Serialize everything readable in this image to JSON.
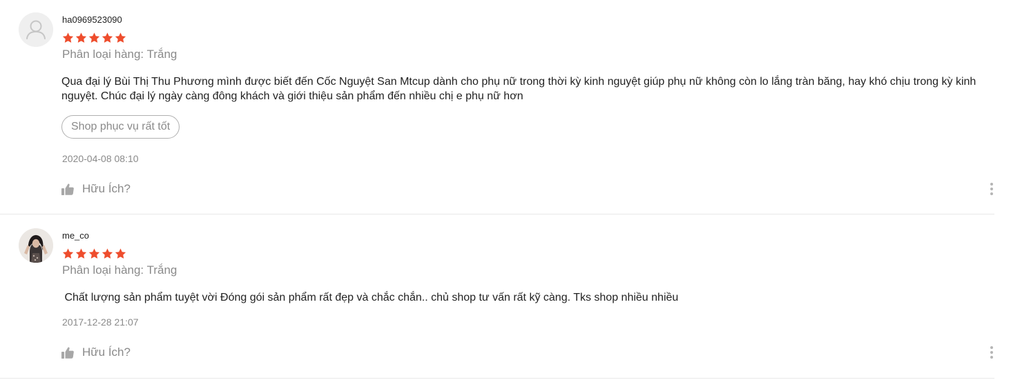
{
  "colors": {
    "star": "#ee4d2d",
    "muted_text": "#8a8a8a",
    "main_text": "#222222",
    "divider": "#e8e8e8"
  },
  "reviews": [
    {
      "username": "ha0969523090",
      "avatar": "default-user-icon",
      "rating": 5,
      "variation": "Phân loại hàng: Trắng",
      "comment": "Qua đại lý Bùi Thị Thu Phương mình được biết đến Cốc Nguyệt San Mtcup dành cho phụ nữ trong thời kỳ kinh nguyệt giúp phụ nữ không còn lo lắng tràn băng, hay khó chịu trong kỳ kinh nguyệt. Chúc đại lý ngày càng đông khách và giới thiệu sản phẩm đến nhiều chị e phụ nữ hơn",
      "tag": "Shop phục vụ rất tốt",
      "date": "2020-04-08 08:10",
      "helpful_label": "Hữu Ích?",
      "like_icon": "thumbs-up-icon",
      "more_icon": "more-vertical-icon"
    },
    {
      "username": "me_co",
      "avatar": "user-photo",
      "rating": 5,
      "variation": "Phân loại hàng: Trắng",
      "comment": " Chất lượng sản phẩm tuyệt vời Đóng gói sản phẩm rất đẹp và chắc chắn.. chủ shop tư vấn rất kỹ càng. Tks shop nhiều nhiều",
      "date": "2017-12-28 21:07",
      "helpful_label": "Hữu Ích?",
      "like_icon": "thumbs-up-icon",
      "more_icon": "more-vertical-icon"
    }
  ]
}
